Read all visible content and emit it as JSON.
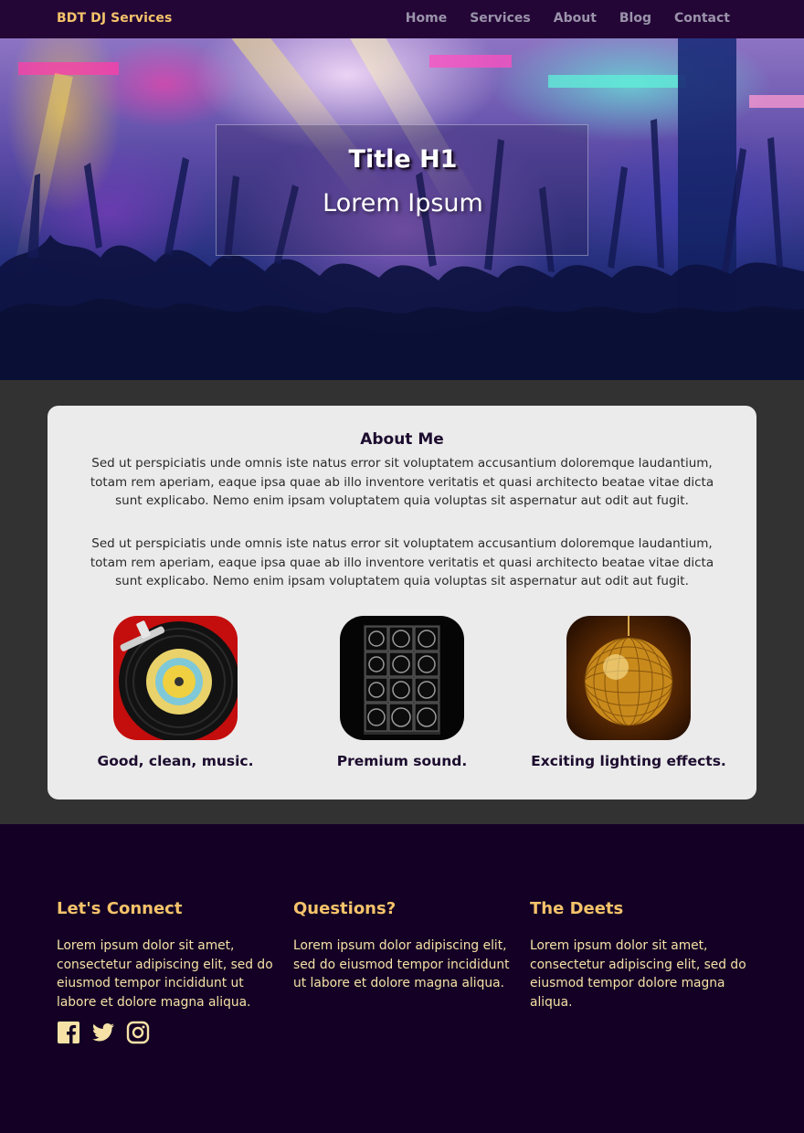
{
  "nav": {
    "brand": "BDT DJ Services",
    "links": [
      "Home",
      "Services",
      "About",
      "Blog",
      "Contact"
    ]
  },
  "hero": {
    "title": "Title H1",
    "subtitle": "Lorem Ipsum"
  },
  "about": {
    "title": "About Me",
    "paragraphs": [
      "Sed ut perspiciatis unde omnis iste natus error sit voluptatem accusantium doloremque laudantium, totam rem aperiam, eaque ipsa quae ab illo inventore veritatis et quasi architecto beatae vitae dicta sunt explicabo. Nemo enim ipsam voluptatem quia voluptas sit aspernatur aut odit aut fugit.",
      "Sed ut perspiciatis unde omnis iste natus error sit voluptatem accusantium doloremque laudantium, totam rem aperiam, eaque ipsa quae ab illo inventore veritatis et quasi architecto beatae vitae dicta sunt explicabo. Nemo enim ipsam voluptatem quia voluptas sit aspernatur aut odit aut fugit."
    ],
    "features": [
      {
        "caption": "Good, clean, music.",
        "icon": "vinyl-record-icon"
      },
      {
        "caption": "Premium sound.",
        "icon": "speaker-stack-icon"
      },
      {
        "caption": "Exciting lighting effects.",
        "icon": "disco-ball-icon"
      }
    ]
  },
  "footer": {
    "columns": [
      {
        "title": "Let's Connect",
        "text": "Lorem ipsum dolor sit amet, consectetur adipiscing elit, sed do eiusmod tempor incididunt ut labore et dolore magna aliqua."
      },
      {
        "title": "Questions?",
        "text": "Lorem ipsum dolor adipiscing elit, sed do eiusmod tempor incididunt ut labore et dolore magna aliqua."
      },
      {
        "title": "The Deets",
        "text": "Lorem ipsum dolor sit amet, consectetur adipiscing elit, sed do eiusmod tempor dolore magna aliqua."
      }
    ],
    "socials": [
      "facebook-icon",
      "twitter-icon",
      "instagram-icon"
    ]
  },
  "colors": {
    "nav_bg": "#230636",
    "accent": "#f4c36a",
    "nav_link": "#9a93aa",
    "section_bg": "#323232",
    "card_bg": "#ebebeb",
    "footer_bg": "#130024",
    "footer_text": "#f6e2a6"
  }
}
